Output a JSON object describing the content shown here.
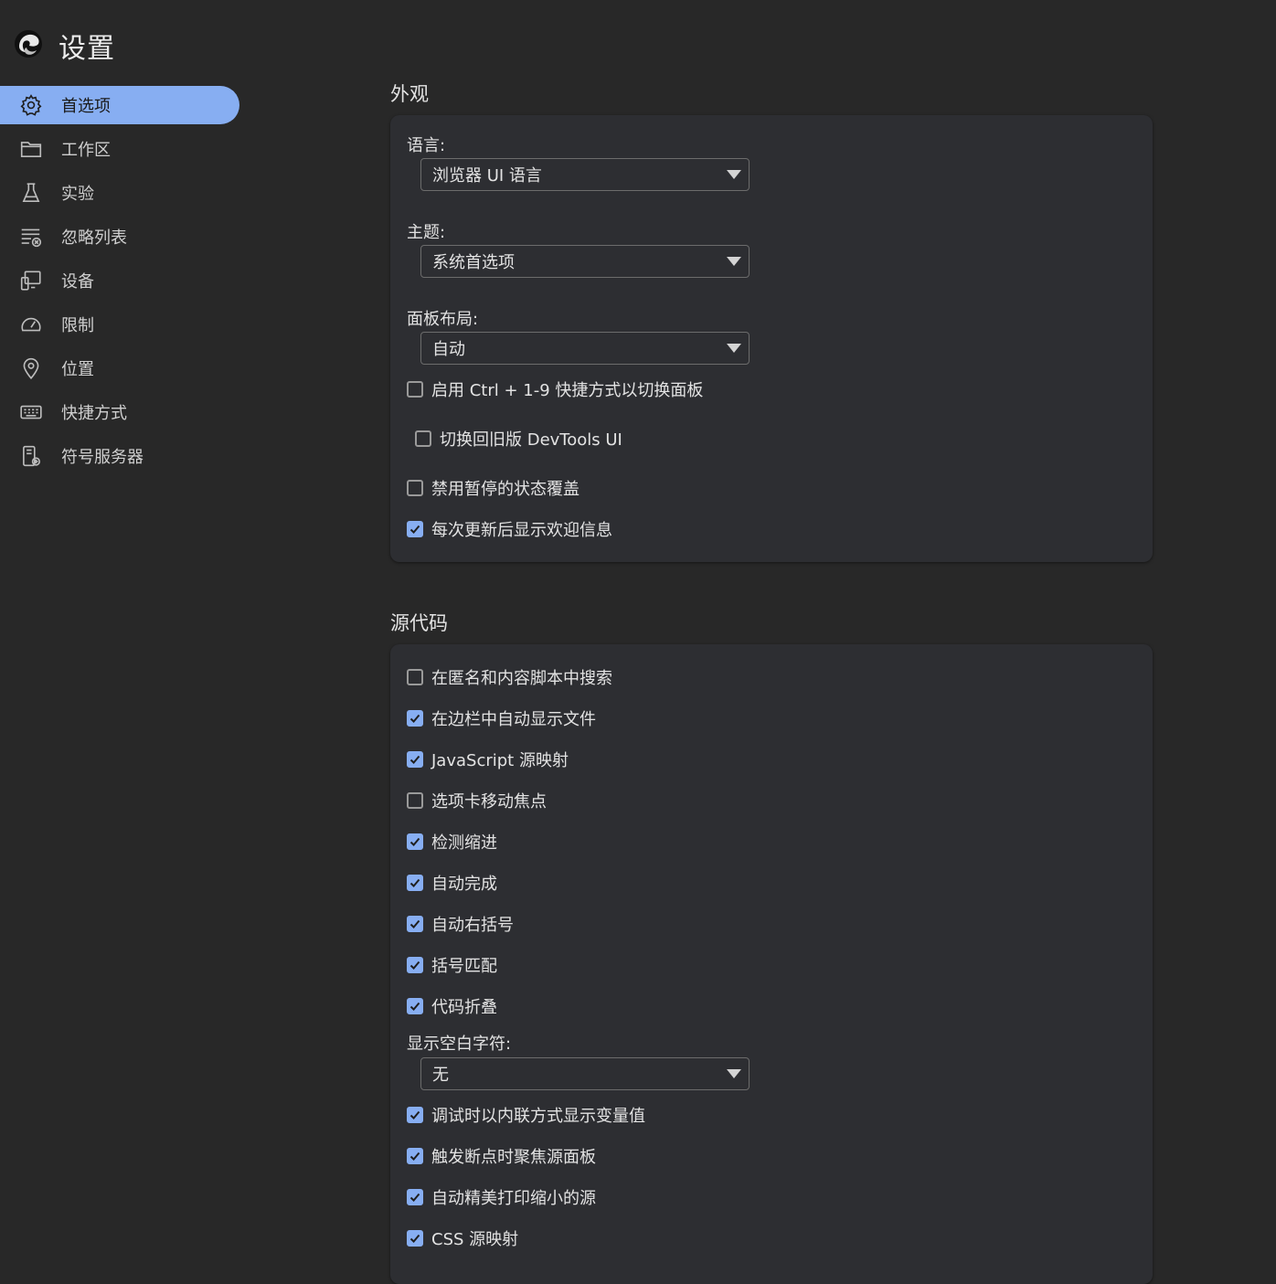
{
  "app": {
    "title": "设置"
  },
  "sidebar": {
    "items": [
      {
        "label": "首选项",
        "icon": "gear-icon",
        "active": true
      },
      {
        "label": "工作区",
        "icon": "folder-icon",
        "active": false
      },
      {
        "label": "实验",
        "icon": "flask-icon",
        "active": false
      },
      {
        "label": "忽略列表",
        "icon": "list-ignore-icon",
        "active": false
      },
      {
        "label": "设备",
        "icon": "devices-icon",
        "active": false
      },
      {
        "label": "限制",
        "icon": "gauge-icon",
        "active": false
      },
      {
        "label": "位置",
        "icon": "location-pin-icon",
        "active": false
      },
      {
        "label": "快捷方式",
        "icon": "keyboard-icon",
        "active": false
      },
      {
        "label": "符号服务器",
        "icon": "symbol-server-icon",
        "active": false
      }
    ]
  },
  "appearance": {
    "title": "外观",
    "language_label": "语言:",
    "language_value": "浏览器 UI 语言",
    "theme_label": "主题:",
    "theme_value": "系统首选项",
    "panel_layout_label": "面板布局:",
    "panel_layout_value": "自动",
    "options": [
      {
        "label": "启用 Ctrl + 1-9 快捷方式以切换面板",
        "checked": false
      },
      {
        "label": "切换回旧版 DevTools UI",
        "checked": false
      },
      {
        "label": "禁用暂停的状态覆盖",
        "checked": false
      },
      {
        "label": "每次更新后显示欢迎信息",
        "checked": true
      }
    ]
  },
  "sources": {
    "title": "源代码",
    "options": [
      {
        "label": "在匿名和内容脚本中搜索",
        "checked": false
      },
      {
        "label": "在边栏中自动显示文件",
        "checked": true
      },
      {
        "label": "JavaScript 源映射",
        "checked": true
      },
      {
        "label": "选项卡移动焦点",
        "checked": false
      },
      {
        "label": "检测缩进",
        "checked": true
      },
      {
        "label": "自动完成",
        "checked": true
      },
      {
        "label": "自动右括号",
        "checked": true
      },
      {
        "label": "括号匹配",
        "checked": true
      },
      {
        "label": "代码折叠",
        "checked": true
      }
    ],
    "whitespace_label": "显示空白字符:",
    "whitespace_value": "无",
    "options2": [
      {
        "label": "调试时以内联方式显示变量值",
        "checked": true
      },
      {
        "label": "触发断点时聚焦源面板",
        "checked": true
      },
      {
        "label": "自动精美打印缩小的源",
        "checked": true
      },
      {
        "label": "CSS 源映射",
        "checked": true
      }
    ]
  },
  "colors": {
    "background": "#282828",
    "card": "#2d2e32",
    "accent": "#87aef2"
  }
}
